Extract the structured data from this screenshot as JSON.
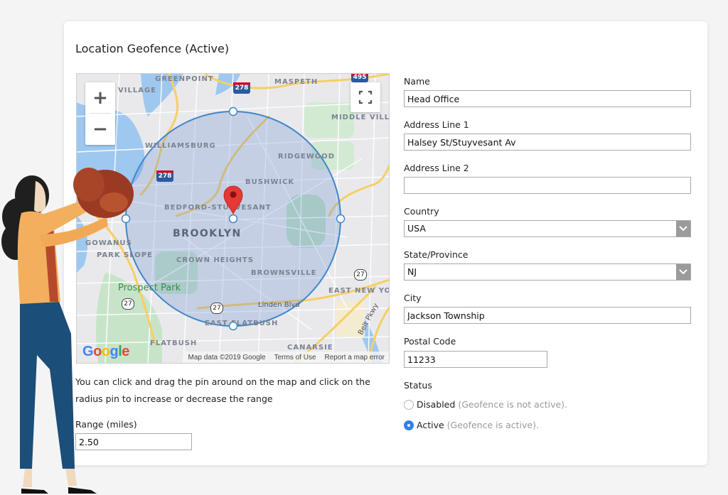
{
  "card": {
    "title": "Location Geofence (Active)"
  },
  "map": {
    "zoom_in_label": "+",
    "zoom_out_label": "−",
    "labels": {
      "greenpoint": "GREENPOINT",
      "maspeth": "MASPETH",
      "village": "VILLAGE",
      "middle_village": "MIDDLE VILLA",
      "williamsburg": "WILLIAMSBURG",
      "ridgewood": "RIDGEWOOD",
      "bushwick": "BUSHWICK",
      "bedford_stuyvesant": "BEDFORD-STUYVESANT",
      "brooklyn": "BROOKLYN",
      "gowanus": "GOWANUS",
      "park_slope": "PARK SLOPE",
      "crown_heights": "CROWN HEIGHTS",
      "brownsville": "BROWNSVILLE",
      "prospect_park": "Prospect Park",
      "east_new_york": "EAST NEW YORK",
      "linden_blvd": "Linden Blvd",
      "east_flatbush": "EAST FLATBUSH",
      "flatbush": "FLATBUSH",
      "canarsie": "CANARSIE",
      "belt_pkwy": "Belt Pkwy"
    },
    "shields": {
      "i278_a": "278",
      "i278_b": "278",
      "i495": "495",
      "r27_a": "27",
      "r27_b": "27",
      "r27_c": "27"
    },
    "footer": {
      "map_data": "Map data ©2019 Google",
      "terms": "Terms of Use",
      "report": "Report a map error"
    },
    "logo_letters": [
      "G",
      "o",
      "o",
      "g",
      "l",
      "e"
    ],
    "geofence_color": "#3f86c9",
    "pin_color": "#e53935"
  },
  "help_text": "You can click and drag the pin around on the map and click on the radius pin to increase or decrease the range",
  "range": {
    "label": "Range (miles)",
    "value": "2.50"
  },
  "form": {
    "name": {
      "label": "Name",
      "value": "Head Office"
    },
    "address1": {
      "label": "Address Line 1",
      "value": "Halsey St/Stuyvesant Av"
    },
    "address2": {
      "label": "Address Line 2",
      "value": ""
    },
    "country": {
      "label": "Country",
      "value": "USA"
    },
    "state": {
      "label": "State/Province",
      "value": "NJ"
    },
    "city": {
      "label": "City",
      "value": "Jackson Township"
    },
    "postal": {
      "label": "Postal Code",
      "value": "11233"
    },
    "status": {
      "label": "Status",
      "options": [
        {
          "label": "Disabled",
          "hint": "(Geofence is not active).",
          "checked": false
        },
        {
          "label": "Active",
          "hint": "(Geofence is active).",
          "checked": true
        }
      ]
    }
  },
  "colors": {
    "radio_active": "#2f7ff0",
    "select_arrow_bg": "#9b9b9b"
  }
}
